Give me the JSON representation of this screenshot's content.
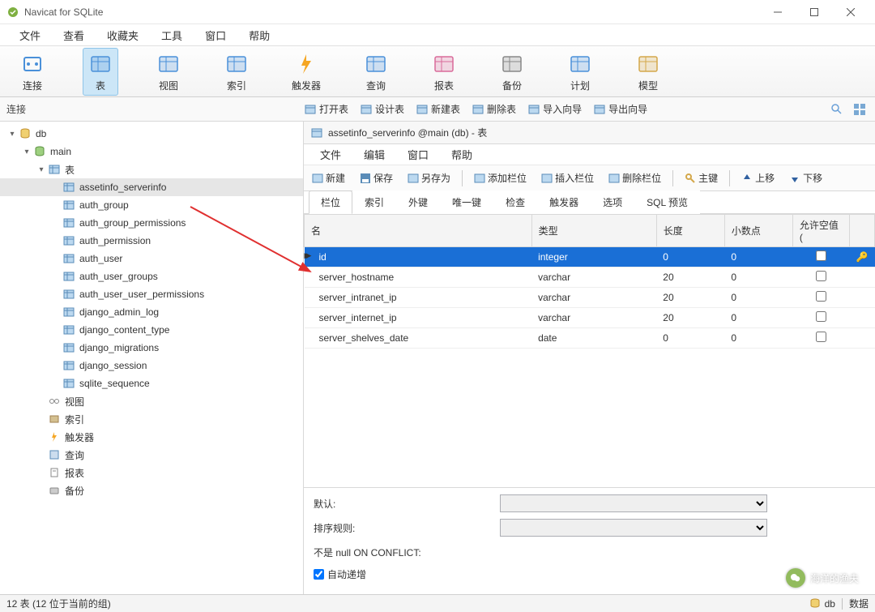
{
  "window": {
    "title": "Navicat for SQLite"
  },
  "menubar": [
    "文件",
    "查看",
    "收藏夹",
    "工具",
    "窗口",
    "帮助"
  ],
  "toolbar": [
    {
      "key": "connect",
      "label": "连接"
    },
    {
      "key": "table",
      "label": "表",
      "active": true
    },
    {
      "key": "view",
      "label": "视图"
    },
    {
      "key": "index",
      "label": "索引"
    },
    {
      "key": "trigger",
      "label": "触发器"
    },
    {
      "key": "query",
      "label": "查询"
    },
    {
      "key": "report",
      "label": "报表"
    },
    {
      "key": "backup",
      "label": "备份"
    },
    {
      "key": "plan",
      "label": "计划"
    },
    {
      "key": "model",
      "label": "模型"
    }
  ],
  "subbar": {
    "left_label": "连接",
    "actions": [
      "打开表",
      "设计表",
      "新建表",
      "删除表",
      "导入向导",
      "导出向导"
    ]
  },
  "tree": {
    "root": "db",
    "schema": "main",
    "tables_label": "表",
    "tables": [
      "assetinfo_serverinfo",
      "auth_group",
      "auth_group_permissions",
      "auth_permission",
      "auth_user",
      "auth_user_groups",
      "auth_user_user_permissions",
      "django_admin_log",
      "django_content_type",
      "django_migrations",
      "django_session",
      "sqlite_sequence"
    ],
    "others": [
      {
        "key": "views",
        "label": "视图"
      },
      {
        "key": "indexes",
        "label": "索引"
      },
      {
        "key": "triggers",
        "label": "触发器"
      },
      {
        "key": "queries",
        "label": "查询"
      },
      {
        "key": "reports",
        "label": "报表"
      },
      {
        "key": "backups",
        "label": "备份"
      }
    ]
  },
  "content": {
    "tab_title": "assetinfo_serverinfo @main (db) - 表",
    "menubar": [
      "文件",
      "编辑",
      "窗口",
      "帮助"
    ],
    "toolbar": [
      {
        "key": "new",
        "label": "新建"
      },
      {
        "key": "save",
        "label": "保存"
      },
      {
        "key": "saveas",
        "label": "另存为"
      },
      {
        "key": "addfield",
        "label": "添加栏位"
      },
      {
        "key": "insertfield",
        "label": "插入栏位"
      },
      {
        "key": "deletefield",
        "label": "删除栏位"
      },
      {
        "key": "primarykey",
        "label": "主键"
      },
      {
        "key": "moveup",
        "label": "上移"
      },
      {
        "key": "movedown",
        "label": "下移"
      }
    ],
    "tabs": [
      "栏位",
      "索引",
      "外键",
      "唯一键",
      "检查",
      "触发器",
      "选项",
      "SQL 预览"
    ],
    "columns_header": [
      "名",
      "类型",
      "长度",
      "小数点",
      "允许空值 ("
    ],
    "columns": [
      {
        "name": "id",
        "type": "integer",
        "length": "0",
        "decimals": "0",
        "nullable": false,
        "pk": true,
        "selected": true
      },
      {
        "name": "server_hostname",
        "type": "varchar",
        "length": "20",
        "decimals": "0",
        "nullable": false
      },
      {
        "name": "server_intranet_ip",
        "type": "varchar",
        "length": "20",
        "decimals": "0",
        "nullable": false
      },
      {
        "name": "server_internet_ip",
        "type": "varchar",
        "length": "20",
        "decimals": "0",
        "nullable": false
      },
      {
        "name": "server_shelves_date",
        "type": "date",
        "length": "0",
        "decimals": "0",
        "nullable": false
      }
    ],
    "fieldpanel": {
      "default_label": "默认:",
      "collation_label": "排序规则:",
      "onconflict_label": "不是 null ON CONFLICT:",
      "autoinc_label": "自动递增",
      "autoinc_checked": true
    }
  },
  "statusbar": {
    "left": "12 表 (12 位于当前的组)",
    "db_label": "db",
    "data_label": "数据"
  },
  "watermark": "海洋的渔夫"
}
